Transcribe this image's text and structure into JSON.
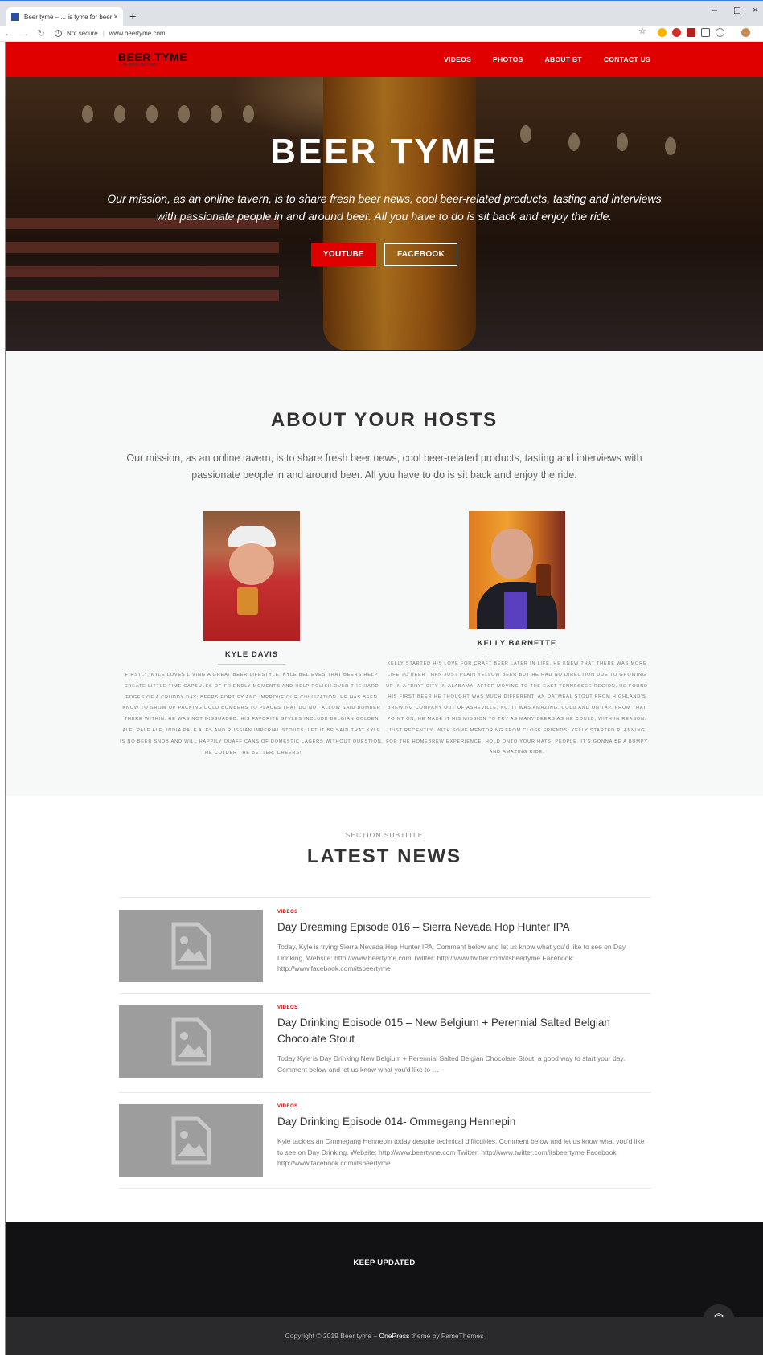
{
  "browser": {
    "tab_title": "Beer tyme – ... is tyme for beer",
    "tab_close": "×",
    "new_tab": "+",
    "security_label": "Not secure",
    "url": "www.beertyme.com",
    "window_controls": [
      "–",
      "☐",
      "×"
    ]
  },
  "header": {
    "brand_title": "BEER TYME",
    "brand_tagline": "... is tyme for beer",
    "menu": [
      "VIDEOS",
      "PHOTOS",
      "ABOUT BT",
      "CONTACT US"
    ],
    "accent_color": "#e00000"
  },
  "hero": {
    "title": "BEER TYME",
    "text": "Our mission, as an online tavern, is to share fresh beer news, cool beer-related products, tasting and interviews with passionate people in and around beer. All you have to do is sit back and enjoy the ride.",
    "primary_button": "YOUTUBE",
    "secondary_button": "FACEBOOK"
  },
  "about": {
    "title": "ABOUT YOUR HOSTS",
    "text": "Our mission, as an online tavern, is to share fresh beer news, cool beer-related products, tasting and interviews with passionate people in and around beer. All you have to do is sit back and enjoy the ride.",
    "hosts": [
      {
        "name": "KYLE DAVIS",
        "bio": "Firstly, Kyle loves living a great beer lifestyle. Kyle believes that beers help create little time capsules of friendly moments and help polish over the hard edges of a cruddy day; beers fortify and improve our civilization. He has been know to show up packing cold bombers to places that do not allow said bomber there within. He was not dissuaded. His favorite styles include Belgian golden ale, pale ale, India pale ales and Russian imperial stouts. Let it be said that Kyle is no beer snob and will happily quaff cans of domestic lagers without question. The colder the better. Cheers!"
      },
      {
        "name": "KELLY BARNETTE",
        "bio": "Kelly started his love for craft beer later in life. He knew that there was more life to beer than just plain yellow beer but he had no direction due to growing up in a \"dry\" city in Alabama. After moving to the East Tennessee region, he found his first beer he thought was much different. An oatmeal stout from Highland's Brewing Company out of Asheville, NC. It was amazing. Cold and on tap. From that point on, he made it his mission to try as many beers as he could, with in reason. Just recently, with some mentoring from close friends, Kelly started planning for the homebrew experience. Hold onto your hats, people. It's gonna be a bumpy and amazing ride."
      }
    ]
  },
  "news": {
    "subtitle": "SECTION SUBTITLE",
    "title": "LATEST NEWS",
    "posts": [
      {
        "category": "VIDEOS",
        "title": "Day Dreaming Episode 016 – Sierra Nevada Hop Hunter IPA",
        "excerpt": "Today, Kyle is trying Sierra Nevada Hop Hunter IPA. Comment below and let us know what you'd like to see on Day Drinking. Website: http://www.beertyme.com Twitter: http://www.twitter.com/itsbeertyme Facebook: http://www.facebook.com/itsbeertyme"
      },
      {
        "category": "VIDEOS",
        "title": "Day Drinking Episode 015 – New Belgium + Perennial Salted Belgian Chocolate Stout",
        "excerpt": "Today Kyle is Day Drinking New Belgium + Perennial Salted Belgian Chocolate Stout, a good way to start your day. Comment below and let us know what you'd like to …"
      },
      {
        "category": "VIDEOS",
        "title": "Day Drinking Episode 014- Ommegang Hennepin",
        "excerpt": "Kyle tackles an Ommegang Hennepin today despite technical difficulties. Comment below and let us know what you'd like to see on Day Drinking. Website: http://www.beertyme.com Twitter: http://www.twitter.com/itsbeertyme Facebook: http://www.facebook.com/itsbeertyme"
      }
    ]
  },
  "footer": {
    "title": "KEEP UPDATED",
    "copyright_prefix": "Copyright © 2019 Beer tyme – ",
    "theme_name": "OnePress",
    "copyright_suffix": " theme by FameThemes",
    "back_to_top": "︽"
  }
}
